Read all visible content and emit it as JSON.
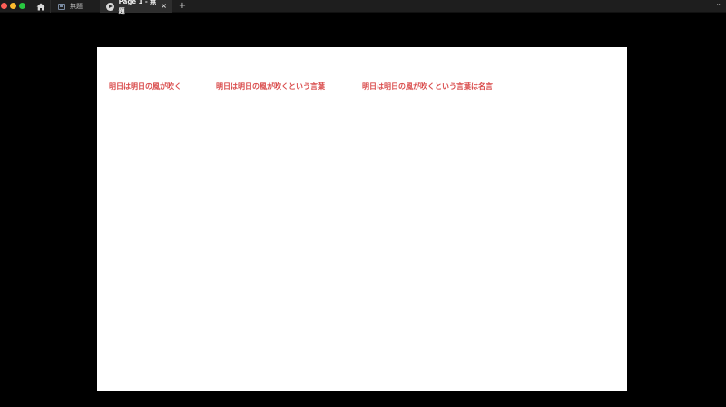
{
  "window": {
    "tabs": [
      {
        "label": "無題",
        "icon": "file-icon"
      },
      {
        "label": "Page 1 - 無題",
        "icon": "play-icon",
        "active": true
      }
    ],
    "new_tab_label": "+",
    "close_label": "×",
    "more_label": "···"
  },
  "canvas": {
    "background": "#ffffff",
    "text_color": "#d94a4a",
    "labels": [
      "明日は明日の風が吹く",
      "明日は明日の風が吹くという言葉",
      "明日は明日の風が吹くという言葉は名言"
    ]
  }
}
